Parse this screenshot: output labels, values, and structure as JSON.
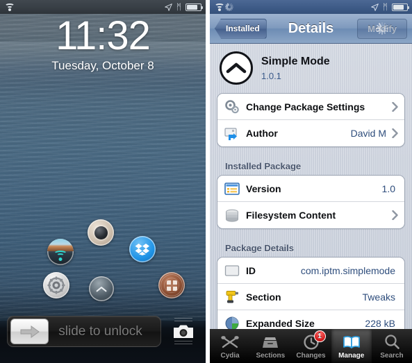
{
  "lockscreen": {
    "status": {
      "wifi_icon": "wifi-icon",
      "location_icon": "location-arrow-icon",
      "bluetooth_icon": "bluetooth-icon",
      "bluetooth_glyph": "ᛗ",
      "battery_icon": "battery-icon"
    },
    "time": "11:32",
    "date": "Tuesday, October 8",
    "icons": [
      {
        "name": "camera-shortcut-icon"
      },
      {
        "name": "wifi-photo-shortcut-icon"
      },
      {
        "name": "dropbox-shortcut-icon"
      },
      {
        "name": "settings-gear-shortcut-icon"
      },
      {
        "name": "simple-mode-chevron-shortcut-icon"
      },
      {
        "name": "cydia-shortcut-icon"
      }
    ],
    "slider": {
      "label": "slide to unlock",
      "knob_icon": "arrow-right-icon"
    },
    "camera_grab": {
      "icon": "camera-icon"
    }
  },
  "cydia": {
    "status": {
      "wifi_icon": "wifi-icon",
      "activity_icon": "activity-spinner-icon",
      "location_icon": "location-arrow-icon",
      "bluetooth_glyph": "ᛗ",
      "battery_icon": "battery-icon"
    },
    "nav": {
      "back_label": "Installed",
      "title": "Details",
      "modify_label": "Modify"
    },
    "package": {
      "icon": "chevron-up-circle-icon",
      "name": "Simple Mode",
      "version": "1.0.1"
    },
    "sections": [
      {
        "header": "",
        "rows": [
          {
            "icon": "gears-icon",
            "label": "Change Package Settings",
            "value": "",
            "disclosure": true
          },
          {
            "icon": "author-card-icon",
            "label": "Author",
            "value": "David M",
            "disclosure": true
          }
        ]
      },
      {
        "header": "Installed Package",
        "rows": [
          {
            "icon": "version-window-icon",
            "label": "Version",
            "value": "1.0",
            "disclosure": false
          },
          {
            "icon": "database-disk-icon",
            "label": "Filesystem Content",
            "value": "",
            "disclosure": true
          }
        ]
      },
      {
        "header": "Package Details",
        "rows": [
          {
            "icon": "id-box-icon",
            "label": "ID",
            "value": "com.iptm.simplemode",
            "disclosure": false
          },
          {
            "icon": "drill-tweaks-icon",
            "label": "Section",
            "value": "Tweaks",
            "disclosure": false
          },
          {
            "icon": "pie-disk-icon",
            "label": "Expanded Size",
            "value": "228 kB",
            "disclosure": false
          }
        ]
      }
    ],
    "tabs": [
      {
        "label": "Cydia",
        "icon": "cydia-scissors-icon",
        "selected": false,
        "badge": ""
      },
      {
        "label": "Sections",
        "icon": "drawer-icon",
        "selected": false,
        "badge": ""
      },
      {
        "label": "Changes",
        "icon": "clock-icon",
        "selected": false,
        "badge": "1"
      },
      {
        "label": "Manage",
        "icon": "book-icon",
        "selected": true,
        "badge": ""
      },
      {
        "label": "Search",
        "icon": "magnifier-icon",
        "selected": false,
        "badge": ""
      }
    ]
  },
  "colors": {
    "cydia_nav": "#7f9abe",
    "accent_value": "#2e4d7c",
    "badge_red": "#d01919",
    "tab_selected": "#ffffff"
  }
}
